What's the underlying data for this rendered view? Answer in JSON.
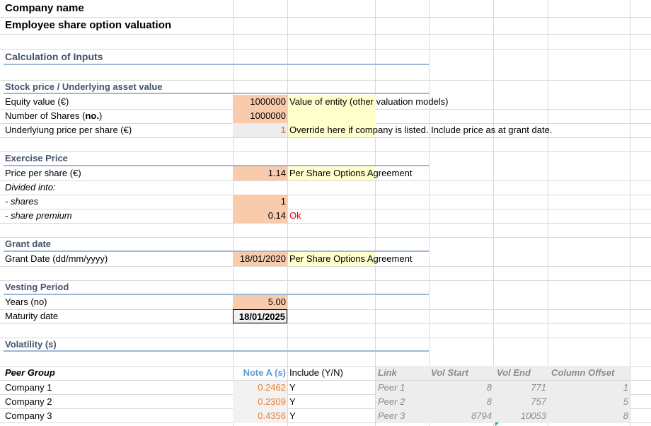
{
  "header": {
    "company": "Company name",
    "title": "Employee share option valuation"
  },
  "sections": {
    "calc_inputs": "Calculation of Inputs",
    "stock_price": "Stock price / Underlying asset value",
    "exercise_price": "Exercise Price",
    "grant_date": "Grant date",
    "vesting_period": "Vesting Period",
    "volatility": "Volatility (s)"
  },
  "rows": {
    "equity_value": {
      "label": "Equity value (€)",
      "value": "1000000",
      "note": "Value of entity (other valuation models)"
    },
    "num_shares": {
      "label_pre": "Number of Shares (",
      "label_bold": "no.",
      "label_post": ")",
      "value": "1000000"
    },
    "underlying_price": {
      "label": "Underlyiung price per share (€)",
      "value": "1",
      "note": "Override here if company is listed. Include price as at grant date."
    },
    "price_per_share": {
      "label": "Price per share (€)",
      "value": "1.14",
      "note": "Per Share Options Agreement"
    },
    "divided_into": {
      "label": "Divided into:"
    },
    "shares": {
      "label": "- shares",
      "value": "1"
    },
    "share_premium": {
      "label": "- share premium",
      "value": "0.14",
      "note": "Ok"
    },
    "grant_date": {
      "label": "Grant Date (dd/mm/yyyy)",
      "value": "18/01/2020",
      "note": "Per Share Options Agreement"
    },
    "years": {
      "label": "Years (no)",
      "value": "5.00"
    },
    "maturity": {
      "label": "Maturity date",
      "value": "18/01/2025"
    }
  },
  "peer_table": {
    "headers": {
      "peer_group": "Peer Group",
      "note_a": "Note A (s)",
      "include": "Include (Y/N)",
      "link": "Link",
      "vol_start": "Vol Start",
      "vol_end": "Vol End",
      "col_offset": "Column Offset"
    },
    "rows": [
      {
        "name": "Company 1",
        "note_a": "0.2462",
        "include": "Y",
        "link": "Peer 1",
        "vol_start": "8",
        "vol_end": "771",
        "col_offset": "1"
      },
      {
        "name": "Company 2",
        "note_a": "0.2309",
        "include": "Y",
        "link": "Peer 2",
        "vol_start": "8",
        "vol_end": "757",
        "col_offset": "5"
      },
      {
        "name": "Company 3",
        "note_a": "0.4356",
        "include": "Y",
        "link": "Peer 3",
        "vol_start": "8794",
        "vol_end": "10053",
        "col_offset": "8"
      }
    ]
  },
  "colors": {
    "input_fill": "#f8cbad",
    "note_fill": "#ffffcc",
    "section_text": "#44546a",
    "section_border": "#9bb7d9",
    "ok_text": "#e00000"
  }
}
